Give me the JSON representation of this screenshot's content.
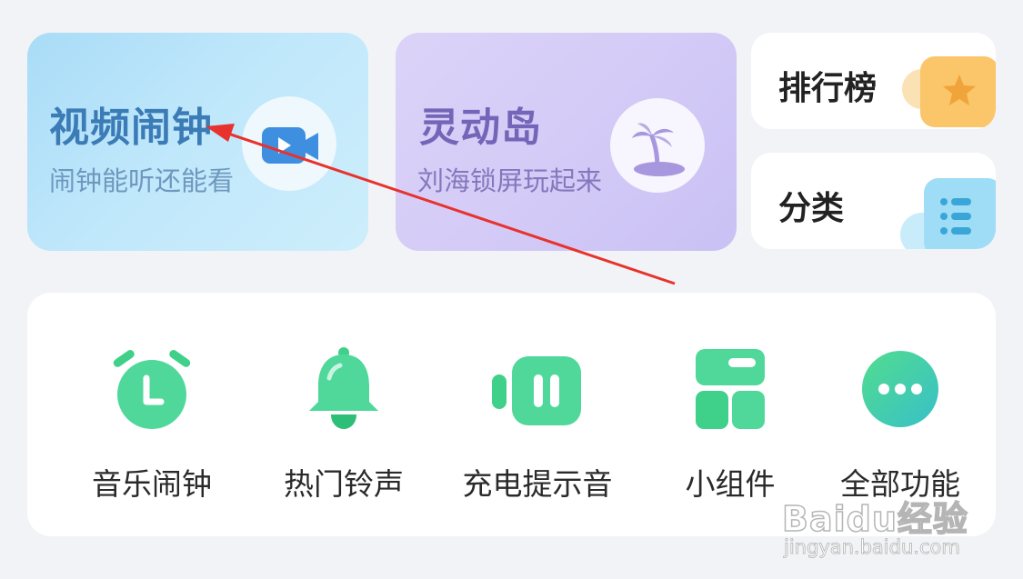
{
  "cards": {
    "video_alarm": {
      "title": "视频闹钟",
      "subtitle": "闹钟能听还能看",
      "icon": "video-play-icon"
    },
    "dynamic_island": {
      "title": "灵动岛",
      "subtitle": "刘海锁屏玩起来",
      "icon": "palm-tree-island-icon"
    }
  },
  "side_cards": {
    "ranking": {
      "label": "排行榜",
      "icon": "star-icon"
    },
    "category": {
      "label": "分类",
      "icon": "list-icon"
    }
  },
  "tools": [
    {
      "label": "音乐闹钟",
      "icon": "alarm-clock-icon"
    },
    {
      "label": "热门铃声",
      "icon": "bell-icon"
    },
    {
      "label": "充电提示音",
      "icon": "charging-battery-icon"
    },
    {
      "label": "小组件",
      "icon": "widget-grid-icon"
    },
    {
      "label": "全部功能",
      "icon": "more-dots-icon"
    }
  ],
  "watermark": {
    "logo": "Baidu经验",
    "url": "jingyan.baidu.com"
  },
  "colors": {
    "accent_green": "#3fd08a",
    "video_card_bg": "#bfe7fb",
    "island_card_bg": "#d4cbf7",
    "annotation_arrow": "#e8322e"
  }
}
